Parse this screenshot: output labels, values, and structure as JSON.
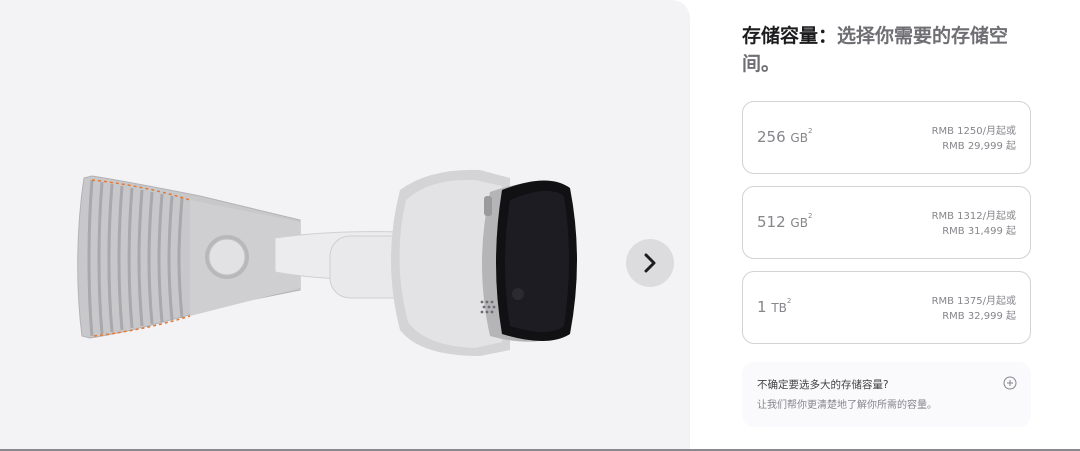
{
  "heading": {
    "label": "存储容量：",
    "question": "选择你需要的存储空间。"
  },
  "options": [
    {
      "capacity": "256",
      "unit": "GB",
      "footnote": "2",
      "monthly": "RMB 1250/月起或",
      "price": "RMB 29,999 起"
    },
    {
      "capacity": "512",
      "unit": "GB",
      "footnote": "2",
      "monthly": "RMB 1312/月起或",
      "price": "RMB 31,499 起"
    },
    {
      "capacity": "1",
      "unit": "TB",
      "footnote": "2",
      "monthly": "RMB 1375/月起或",
      "price": "RMB 32,999 起"
    }
  ],
  "help": {
    "question": "不确定要选多大的存储容量?",
    "answer": "让我们帮你更清楚地了解你所需的容量。"
  },
  "icons": {
    "next": "chevron-right-icon",
    "expand": "plus-circle-icon"
  },
  "colors": {
    "gallery_bg": "#f3f3f5",
    "border": "#d2d2d7",
    "muted_text": "#86868b"
  }
}
